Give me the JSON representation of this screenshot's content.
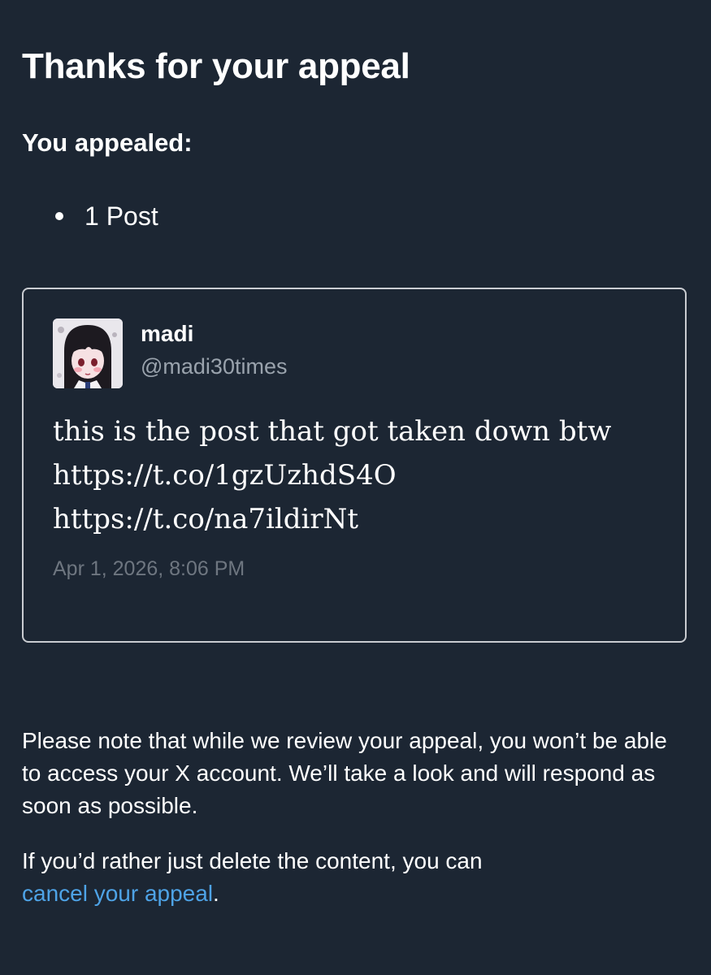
{
  "page": {
    "title": "Thanks for your appeal",
    "appealed_label": "You appealed:",
    "appealed_items": [
      "1 Post"
    ]
  },
  "post": {
    "display_name": "madi",
    "handle": "@madi30times",
    "text_lines": [
      "this is the post that got taken down btw",
      "https://t.co/1gzUzhdS4O",
      "https://t.co/na7ildirNt"
    ],
    "timestamp": "Apr 1, 2026, 8:06 PM",
    "avatar_icon": "user-avatar-image"
  },
  "notice": {
    "text": "Please note that while we review your appeal, you won’t be able to access your X account. We’ll take a look and will respond as soon as possible.",
    "cancel_prefix": "If you’d rather just delete the content, you can",
    "cancel_link": "cancel your appeal",
    "cancel_suffix": "."
  },
  "colors": {
    "background": "#1c2633",
    "link": "#4ea3e6",
    "secondary_text": "#9aa3ad",
    "timestamp_text": "#6e7680",
    "card_border": "#c9ccd1"
  }
}
